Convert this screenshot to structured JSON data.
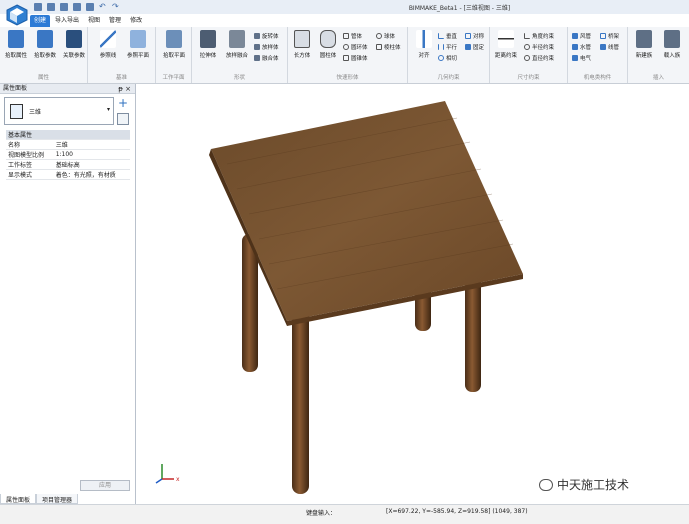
{
  "app": {
    "title": "BIMMAKE_Beta1 - [三维视图 - 三维]",
    "undo_label": "↶",
    "redo_label": "↷"
  },
  "tabs": [
    "创建",
    "导入导出",
    "视图",
    "管理",
    "修改"
  ],
  "ribbon": {
    "groups": {
      "attr": "属性",
      "base": "基准",
      "workplane": "工作平面",
      "shape": "形状",
      "quick": "快速形体",
      "geom": "几何约束",
      "dim": "尺寸约束",
      "mep": "机电类构件",
      "insert": "插入"
    },
    "buttons": {
      "attr1": "拾取属性",
      "attr2": "拾取参数",
      "attr3": "关联参数",
      "ref_line": "参照线",
      "ref_plane": "参照平面",
      "set_plane": "拾取平面",
      "extrude": "拉伸体",
      "loft": "放样融合",
      "revolve": "旋转体",
      "sweep": "放样体",
      "blend": "融合体",
      "box": "长方体",
      "cyl": "圆柱体",
      "pipe": "管体",
      "ring": "圆环体",
      "cone": "圆锥体",
      "sphere": "球体",
      "prism": "棱柱体",
      "align": "对齐",
      "vert": "垂直",
      "para": "平行",
      "tang": "相切",
      "sym": "对称",
      "fix": "固定",
      "dist": "距离约束",
      "angle": "角度约束",
      "radius": "半径约束",
      "diam": "直径约束",
      "duct": "风管",
      "pipe_mep": "水管",
      "elec": "电气",
      "bridge": "桥架",
      "cable": "线管",
      "new_family": "新建族",
      "load_family": "载入族"
    }
  },
  "panel": {
    "title": "属性面板",
    "pin": "ᵽ ×",
    "type_name": "三维",
    "add": "+",
    "section": "基本属性",
    "rows": [
      {
        "k": "名称",
        "v": "三维"
      },
      {
        "k": "视图模型比例",
        "v": "1:100"
      },
      {
        "k": "工作标签",
        "v": "基础标高"
      },
      {
        "k": "显示模式",
        "v": "着色：有光照，有材质"
      }
    ],
    "apply": "应用",
    "tab1": "属性面板",
    "tab2": "项目管理器"
  },
  "viewport": {
    "axis_x": "x",
    "axis_z": "z",
    "axis_y": "y"
  },
  "status": {
    "label": "键盘输入：",
    "coords": "[X=697.22, Y=-585.94, Z=919.58] (1049, 387)"
  },
  "watermark": "中天施工技术"
}
